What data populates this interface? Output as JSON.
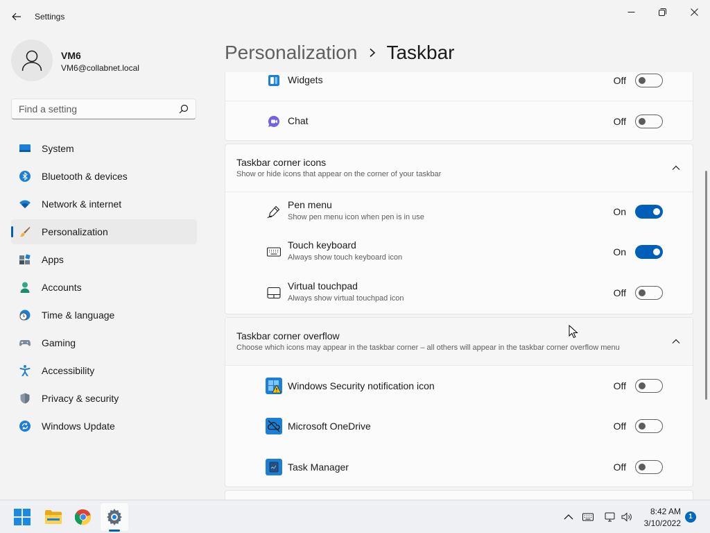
{
  "window": {
    "title": "Settings",
    "colors": {
      "accent": "#005fb8",
      "background": "#f3f3f3",
      "card": "#fbfbfb"
    }
  },
  "user": {
    "name": "VM6",
    "email": "VM6@collabnet.local"
  },
  "search": {
    "placeholder": "Find a setting"
  },
  "sidebar": {
    "items": [
      {
        "label": "System",
        "icon": "monitor-icon",
        "selected": false
      },
      {
        "label": "Bluetooth & devices",
        "icon": "bluetooth-icon",
        "selected": false
      },
      {
        "label": "Network & internet",
        "icon": "wifi-icon",
        "selected": false
      },
      {
        "label": "Personalization",
        "icon": "brush-icon",
        "selected": true
      },
      {
        "label": "Apps",
        "icon": "apps-icon",
        "selected": false
      },
      {
        "label": "Accounts",
        "icon": "person-icon",
        "selected": false
      },
      {
        "label": "Time & language",
        "icon": "globe-clock-icon",
        "selected": false
      },
      {
        "label": "Gaming",
        "icon": "gamepad-icon",
        "selected": false
      },
      {
        "label": "Accessibility",
        "icon": "accessibility-icon",
        "selected": false
      },
      {
        "label": "Privacy & security",
        "icon": "shield-icon",
        "selected": false
      },
      {
        "label": "Windows Update",
        "icon": "update-icon",
        "selected": false
      }
    ]
  },
  "breadcrumb": {
    "parent": "Personalization",
    "current": "Taskbar"
  },
  "taskbar_items": {
    "rows": [
      {
        "title": "Widgets",
        "icon": "widgets-icon",
        "state": "Off",
        "on": false
      },
      {
        "title": "Chat",
        "icon": "chat-icon",
        "state": "Off",
        "on": false
      }
    ]
  },
  "corner_icons": {
    "title": "Taskbar corner icons",
    "description": "Show or hide icons that appear on the corner of your taskbar",
    "rows": [
      {
        "title": "Pen menu",
        "description": "Show pen menu icon when pen is in use",
        "icon": "pen-icon",
        "state": "On",
        "on": true
      },
      {
        "title": "Touch keyboard",
        "description": "Always show touch keyboard icon",
        "icon": "keyboard-icon",
        "state": "On",
        "on": true
      },
      {
        "title": "Virtual touchpad",
        "description": "Always show virtual touchpad icon",
        "icon": "touchpad-icon",
        "state": "Off",
        "on": false
      }
    ]
  },
  "corner_overflow": {
    "title": "Taskbar corner overflow",
    "description": "Choose which icons may appear in the taskbar corner – all others will appear in the taskbar corner overflow menu",
    "rows": [
      {
        "title": "Windows Security notification icon",
        "icon": "windows-security-icon",
        "state": "Off",
        "on": false
      },
      {
        "title": "Microsoft OneDrive",
        "icon": "onedrive-icon",
        "state": "Off",
        "on": false
      },
      {
        "title": "Task Manager",
        "icon": "task-manager-icon",
        "state": "Off",
        "on": false
      }
    ]
  },
  "system_taskbar": {
    "apps": [
      "start-icon",
      "file-explorer-icon",
      "chrome-icon",
      "settings-icon"
    ],
    "time": "8:42 AM",
    "date": "3/10/2022",
    "notifications": "1"
  }
}
